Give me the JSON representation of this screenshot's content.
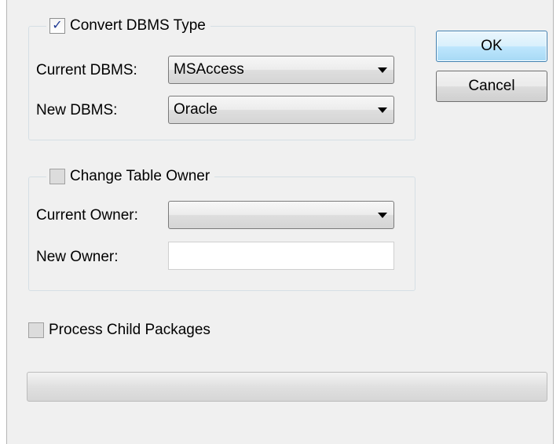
{
  "convert_group": {
    "title": "Convert DBMS Type",
    "checked": true,
    "current_dbms_label": "Current DBMS:",
    "current_dbms_value": "MSAccess",
    "new_dbms_label": "New DBMS:",
    "new_dbms_value": "Oracle"
  },
  "owner_group": {
    "title": "Change Table Owner",
    "checked": false,
    "current_owner_label": "Current Owner:",
    "current_owner_value": "",
    "new_owner_label": "New Owner:",
    "new_owner_value": ""
  },
  "process_child": {
    "label": "Process Child Packages",
    "checked": false
  },
  "buttons": {
    "ok": "OK",
    "cancel": "Cancel"
  },
  "progress": {
    "value": 0
  },
  "icons": {
    "checkbox_tick": "✓"
  }
}
